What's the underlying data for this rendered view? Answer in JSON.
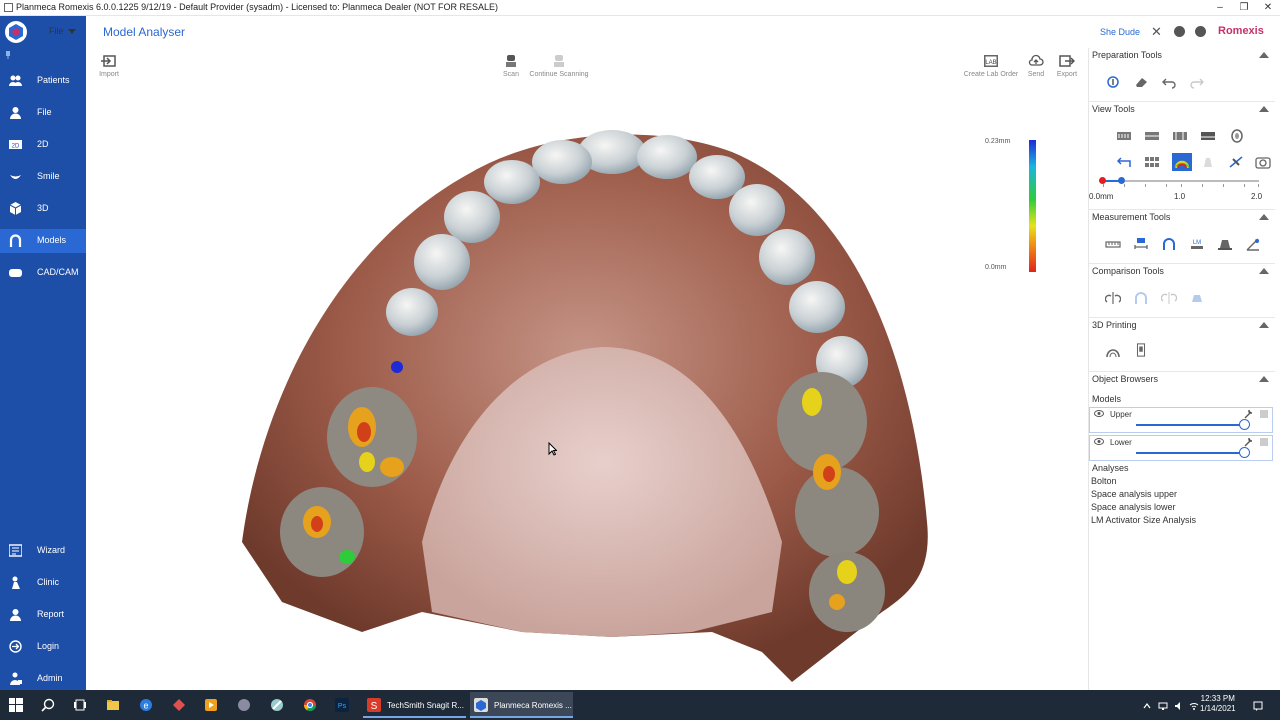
{
  "window": {
    "title": "Planmeca Romexis 6.0.0.1225 9/12/19 - Default Provider (sysadm) - Licensed to: Planmeca Dealer (NOT FOR RESALE)",
    "controls": [
      "minimize",
      "restore",
      "close"
    ]
  },
  "header": {
    "file_menu": "File",
    "title": "Model Analyser",
    "user": "She Dude",
    "brand": "Romexis"
  },
  "sidebar": {
    "items": [
      {
        "label": "Patients",
        "icon": "patients-icon"
      },
      {
        "label": "File",
        "icon": "file-icon"
      },
      {
        "label": "2D",
        "icon": "2d-icon"
      },
      {
        "label": "Smile",
        "icon": "smile-icon"
      },
      {
        "label": "3D",
        "icon": "3d-icon"
      },
      {
        "label": "Models",
        "icon": "models-icon",
        "active": true
      },
      {
        "label": "CAD/CAM",
        "icon": "cadcam-icon"
      },
      {
        "label": "Wizard",
        "icon": "wizard-icon"
      },
      {
        "label": "Clinic",
        "icon": "clinic-icon"
      },
      {
        "label": "Report",
        "icon": "report-icon"
      },
      {
        "label": "Login",
        "icon": "login-icon"
      },
      {
        "label": "Admin",
        "icon": "admin-icon"
      }
    ]
  },
  "toolbar": {
    "import": "Import",
    "scan": "Scan",
    "continue_scanning": "Continue Scanning",
    "create_lab_order": "Create Lab Order",
    "send": "Send",
    "export": "Export"
  },
  "viewport": {
    "scale_max": "0.23mm",
    "scale_min": "0.0mm",
    "scale_colors": [
      "#1d2bd6",
      "#2ecc3a",
      "#e6e21a",
      "#e0241a"
    ]
  },
  "panel": {
    "preparation_tools": "Preparation Tools",
    "view_tools": "View Tools",
    "measurement_tools": "Measurement Tools",
    "comparison_tools": "Comparison Tools",
    "printing": "3D Printing",
    "object_browsers": "Object Browsers",
    "slider": {
      "min_label": "0.0mm",
      "mid_label": "1.0",
      "max_label": "2.0",
      "value_low": 0.0,
      "value_high": 0.2
    },
    "models_label": "Models",
    "models": [
      {
        "name": "Upper",
        "visible": true,
        "opacity": 0.92
      },
      {
        "name": "Lower",
        "visible": true,
        "opacity": 0.92
      }
    ],
    "analyses_label": "Analyses",
    "analyses": [
      "Bolton",
      "Space analysis upper",
      "Space analysis lower",
      "LM Activator Size Analysis"
    ]
  },
  "taskbar": {
    "apps": [
      {
        "label": "TechSmith Snagit R...",
        "icon": "snagit-icon"
      },
      {
        "label": "Planmeca Romexis ...",
        "icon": "romexis-icon",
        "active": true
      }
    ],
    "time": "12:33 PM",
    "date": "1/14/2021"
  },
  "colors": {
    "sidebar": "#1e4fa8",
    "accent": "#2a69d4",
    "brand": "#c5306a"
  }
}
